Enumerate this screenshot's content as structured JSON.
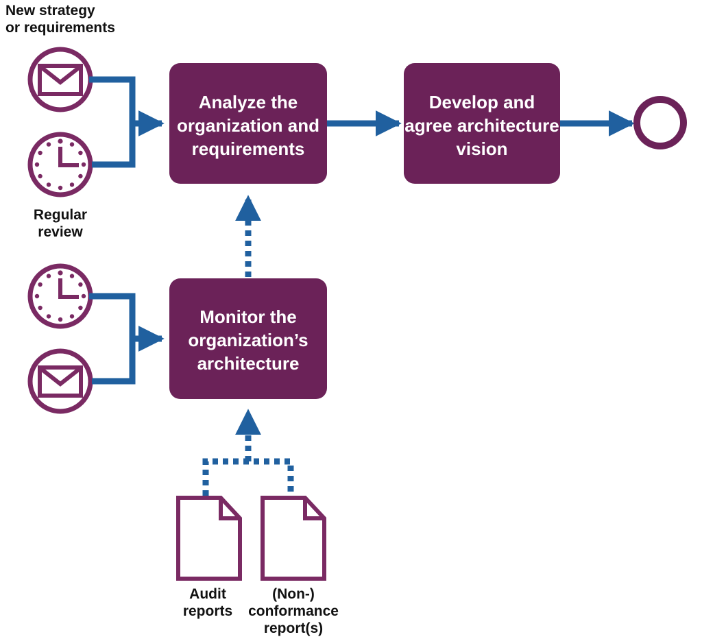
{
  "diagram": {
    "title_note": "BPMN process diagram",
    "colors": {
      "task_fill": "#6B2258",
      "icon_stroke": "#7A2A63",
      "connector_blue": "#20609F",
      "text_on_task": "#FFFFFF",
      "text_dark": "#111111",
      "background": "#FFFFFF"
    },
    "annotations": {
      "new_strategy": "New strategy\nor requirements",
      "new_strategy_line1": "New strategy",
      "new_strategy_line2": "or requirements",
      "regular_review_line1": "Regular",
      "regular_review_line2": "review"
    },
    "tasks": [
      {
        "id": "analyze",
        "lines": [
          "Analyze the",
          "organization and",
          "requirements"
        ]
      },
      {
        "id": "develop",
        "lines": [
          "Develop and",
          "agree architecture",
          "vision"
        ]
      },
      {
        "id": "monitor",
        "lines": [
          "Monitor the",
          "organization’s",
          "architecture"
        ]
      }
    ],
    "events": [
      {
        "id": "start-message-top",
        "icon": "envelope-icon",
        "type": "message-start-event"
      },
      {
        "id": "start-timer-top",
        "icon": "clock-icon",
        "type": "timer-start-event"
      },
      {
        "id": "start-timer-bottom",
        "icon": "clock-icon",
        "type": "timer-start-event"
      },
      {
        "id": "start-message-bottom",
        "icon": "envelope-icon",
        "type": "message-start-event"
      },
      {
        "id": "end-event",
        "icon": "circle-icon",
        "type": "end-event"
      }
    ],
    "data_objects": [
      {
        "id": "audit-reports",
        "icon": "document-icon",
        "lines": [
          "Audit",
          "reports"
        ]
      },
      {
        "id": "nonconformance-reports",
        "icon": "document-icon",
        "lines": [
          "(Non-)",
          "conformance",
          "report(s)"
        ]
      }
    ]
  }
}
